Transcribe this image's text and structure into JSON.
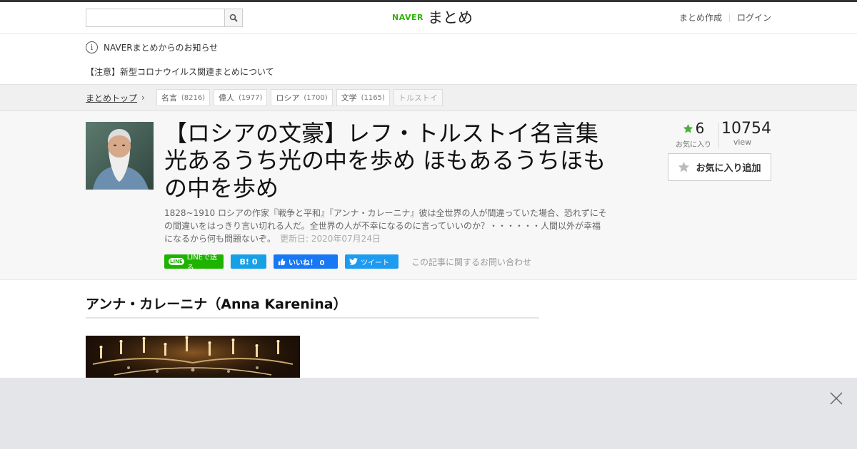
{
  "header": {
    "search": {
      "value": "",
      "placeholder": ""
    },
    "logo": {
      "naver": "NAVER",
      "matome": "まとめ"
    },
    "nav": {
      "create": "まとめ作成",
      "login": "ログイン"
    }
  },
  "notice": {
    "title": "NAVERまとめからのお知らせ",
    "link": "【注意】新型コロナウイルス関連まとめについて"
  },
  "breadcrumb": {
    "top": "まとめトップ",
    "tags": [
      {
        "label": "名言",
        "count": "(8216)"
      },
      {
        "label": "偉人",
        "count": "(1977)"
      },
      {
        "label": "ロシア",
        "count": "(1700)"
      },
      {
        "label": "文学",
        "count": "(1165)"
      }
    ],
    "current": "トルストイ"
  },
  "article": {
    "title": "【ロシアの文豪】レフ・トルストイ名言集 光あるうち光の中を歩め ほもあるうちほもの中を歩め",
    "description": "1828~1910 ロシアの作家『戦争と平和』『アンナ・カレーニナ』彼は全世界の人が間違っていた場合、恐れずにその間違いをはっきり言い切れる人だ。全世界の人が不幸になるのに言っていいのか？・・・・・・人間以外が幸福になるから何も問題ないぞ。",
    "updated": "更新日: 2020年07月24日",
    "favorites": "6",
    "favorites_label": "お気に入り",
    "views": "10754",
    "views_label": "view",
    "fav_button": "お気に入り追加"
  },
  "share": {
    "line": "LINEで送る",
    "line_badge": "LINE",
    "hatena": "0",
    "hatena_icon": "B!",
    "fb": "いいね！ 0",
    "tw": "ツイート",
    "contact": "この記事に関するお問い合わせ"
  },
  "section": {
    "heading": "アンナ・カレーニナ（Anna Karenina）"
  },
  "colors": {
    "naver_green": "#2db400",
    "line_green": "#1eb300",
    "hatena_blue": "#18a0e6",
    "fb_blue": "#1877f2",
    "tw_blue": "#1d9bf0",
    "fav_star": "#4cae3e"
  }
}
